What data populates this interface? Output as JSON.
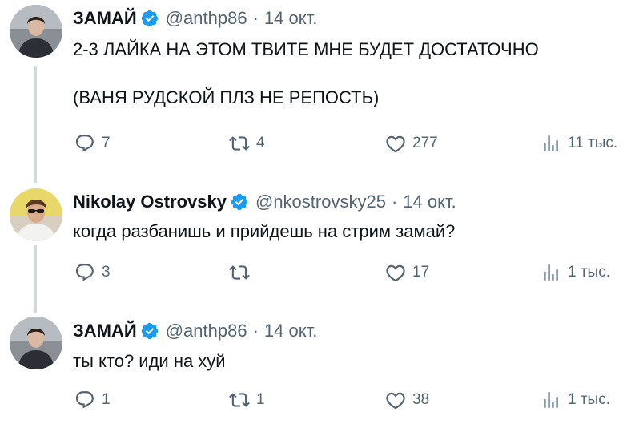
{
  "tweets": [
    {
      "name": "ЗАМАЙ",
      "handle": "@anthp86",
      "separator": "·",
      "date": "14 окт.",
      "text": "2-3 ЛАЙКА НА ЭТОМ ТВИТЕ МНЕ БУДЕТ ДОСТАТОЧНО\n\n(ВАНЯ РУДСКОЙ ПЛЗ НЕ РЕПОСТЬ)",
      "replies": "7",
      "retweets": "4",
      "likes": "277",
      "views": "11 тыс."
    },
    {
      "name": "Nikolay Ostrovsky",
      "handle": "@nkostrovsky25",
      "separator": "·",
      "date": "14 окт.",
      "text": "когда разбанишь и прийдешь на стрим замай?",
      "replies": "3",
      "retweets": "",
      "likes": "17",
      "views": "1 тыс."
    },
    {
      "name": "ЗАМАЙ",
      "handle": "@anthp86",
      "separator": "·",
      "date": "14 окт.",
      "text": "ты кто? иди на хуй",
      "replies": "1",
      "retweets": "1",
      "likes": "38",
      "views": "1 тыс."
    }
  ],
  "colors": {
    "verified": "#1d9bf0",
    "secondary_text": "#536471",
    "thread_line": "#cfd9de"
  },
  "icons": [
    "reply-icon",
    "retweet-icon",
    "like-icon",
    "views-icon",
    "verified-badge-icon"
  ]
}
